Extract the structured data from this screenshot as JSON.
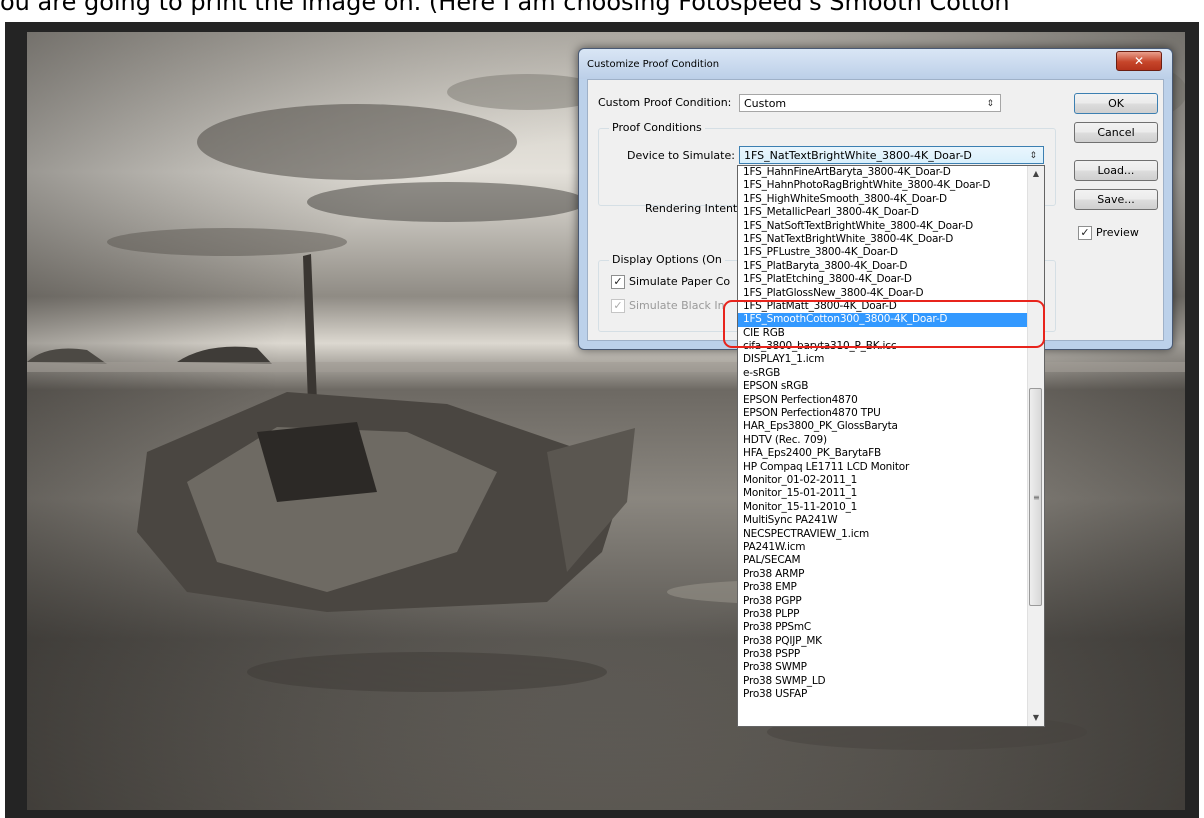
{
  "caption": "ou are going to print the image on. (Here I am choosing Fotospeed's Smooth Cotton",
  "dialog": {
    "title": "Customize Proof Condition",
    "close_glyph": "✕",
    "custom_condition_label": "Custom Proof Condition:",
    "custom_condition_value": "Custom",
    "proof_conditions_legend": "Proof Conditions",
    "device_label": "Device to Simulate:",
    "device_value": "1FS_NatTextBrightWhite_3800-4K_Doar-D",
    "rendering_intent_label": "Rendering Intent:",
    "display_options_legend": "Display Options (On",
    "simulate_paper_label": "Simulate Paper Co",
    "simulate_black_label": "Simulate Black In",
    "buttons": {
      "ok": "OK",
      "cancel": "Cancel",
      "load": "Load...",
      "save": "Save..."
    },
    "preview_label": "Preview",
    "check_glyph": "✓"
  },
  "dropdown": {
    "selected_index": 12,
    "items": [
      "1FS_HahnFineArtBaryta_3800-4K_Doar-D",
      "1FS_HahnPhotoRagBrightWhite_3800-4K_Doar-D",
      "1FS_HighWhiteSmooth_3800-4K_Doar-D",
      "1FS_MetallicPearl_3800-4K_Doar-D",
      "1FS_NatSoftTextBrightWhite_3800-4K_Doar-D",
      "1FS_NatTextBrightWhite_3800-4K_Doar-D",
      "1FS_PFLustre_3800-4K_Doar-D",
      "1FS_PlatBaryta_3800-4K_Doar-D",
      "1FS_PlatEtching_3800-4K_Doar-D",
      "1FS_PlatGlossNew_3800-4K_Doar-D",
      "1FS_PlatMatt_3800-4K_Doar-D",
      "1FS_SmoothCotton300_3800-4K_Doar-D",
      "CIE RGB",
      "cifa_3800_baryta310_P_BK.icc",
      "DISPLAY1_1.icm",
      "e-sRGB",
      "EPSON  sRGB",
      "EPSON Perfection4870",
      "EPSON Perfection4870 TPU",
      "HAR_Eps3800_PK_GlossBaryta",
      "HDTV (Rec. 709)",
      "HFA_Eps2400_PK_BarytaFB",
      "HP Compaq LE1711 LCD Monitor",
      "Monitor_01-02-2011_1",
      "Monitor_15-01-2011_1",
      "Monitor_15-11-2010_1",
      "MultiSync PA241W",
      "NECSPECTRAVIEW_1.icm",
      "PA241W.icm",
      "PAL/SECAM",
      "Pro38 ARMP",
      "Pro38 EMP",
      "Pro38 PGPP",
      "Pro38 PLPP",
      "Pro38 PPSmC",
      "Pro38 PQIJP_MK",
      "Pro38 PSPP",
      "Pro38 SWMP",
      "Pro38 SWMP_LD",
      "Pro38 USFAP"
    ],
    "scroll_up_glyph": "▲",
    "scroll_down_glyph": "▼",
    "grip_glyph": "≡"
  },
  "colors": {
    "selection": "#3399ff",
    "highlight_ring": "#e8241c"
  }
}
